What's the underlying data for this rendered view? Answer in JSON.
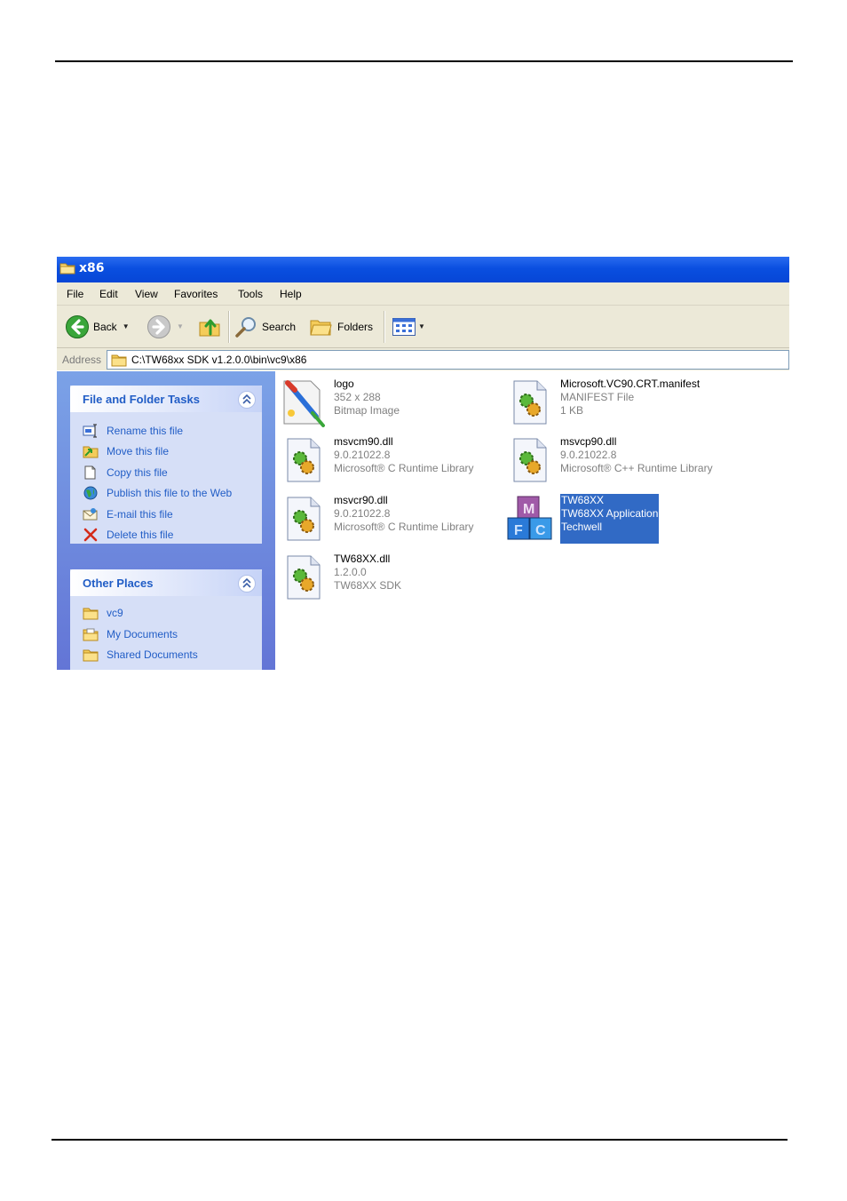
{
  "window": {
    "title": "x86"
  },
  "menu": [
    "File",
    "Edit",
    "View",
    "Favorites",
    "Tools",
    "Help"
  ],
  "toolbar": {
    "back": "Back",
    "search": "Search",
    "folders": "Folders"
  },
  "address": {
    "label": "Address",
    "value": "C:\\TW68xx SDK v1.2.0.0\\bin\\vc9\\x86"
  },
  "tasks": {
    "title": "File and Folder Tasks",
    "items": [
      {
        "label": "Rename this file",
        "icon": "rename-icon"
      },
      {
        "label": "Move this file",
        "icon": "move-icon"
      },
      {
        "label": "Copy this file",
        "icon": "copy-icon"
      },
      {
        "label": "Publish this file to the Web",
        "icon": "globe-icon"
      },
      {
        "label": "E-mail this file",
        "icon": "email-icon"
      },
      {
        "label": "Delete this file",
        "icon": "delete-icon"
      }
    ]
  },
  "places": {
    "title": "Other Places",
    "items": [
      {
        "label": "vc9",
        "icon": "folder-icon"
      },
      {
        "label": "My Documents",
        "icon": "my-documents-icon"
      },
      {
        "label": "Shared Documents",
        "icon": "folder-icon"
      }
    ]
  },
  "files": [
    {
      "name": "logo",
      "line2": "352 x 288",
      "line3": "Bitmap Image",
      "icon": "paint-icon"
    },
    {
      "name": "Microsoft.VC90.CRT.manifest",
      "line2": "MANIFEST File",
      "line3": "1 KB",
      "icon": "system-file-icon"
    },
    {
      "name": "msvcm90.dll",
      "line2": "9.0.21022.8",
      "line3": "Microsoft® C Runtime Library",
      "icon": "system-file-icon"
    },
    {
      "name": "msvcp90.dll",
      "line2": "9.0.21022.8",
      "line3": "Microsoft® C++ Runtime Library",
      "icon": "system-file-icon"
    },
    {
      "name": "msvcr90.dll",
      "line2": "9.0.21022.8",
      "line3": "Microsoft® C Runtime Library",
      "icon": "system-file-icon"
    },
    {
      "name": "TW68XX",
      "line2": "TW68XX Application",
      "line3": "Techwell",
      "icon": "mfc-app-icon",
      "selected": true
    },
    {
      "name": "TW68XX.dll",
      "line2": "1.2.0.0",
      "line3": "TW68XX SDK",
      "icon": "system-file-icon"
    }
  ],
  "colors": {
    "titlebar": "#0a4fe0",
    "selection": "#316ac5",
    "link": "#215dc6",
    "pane": "#6f8ddf"
  }
}
